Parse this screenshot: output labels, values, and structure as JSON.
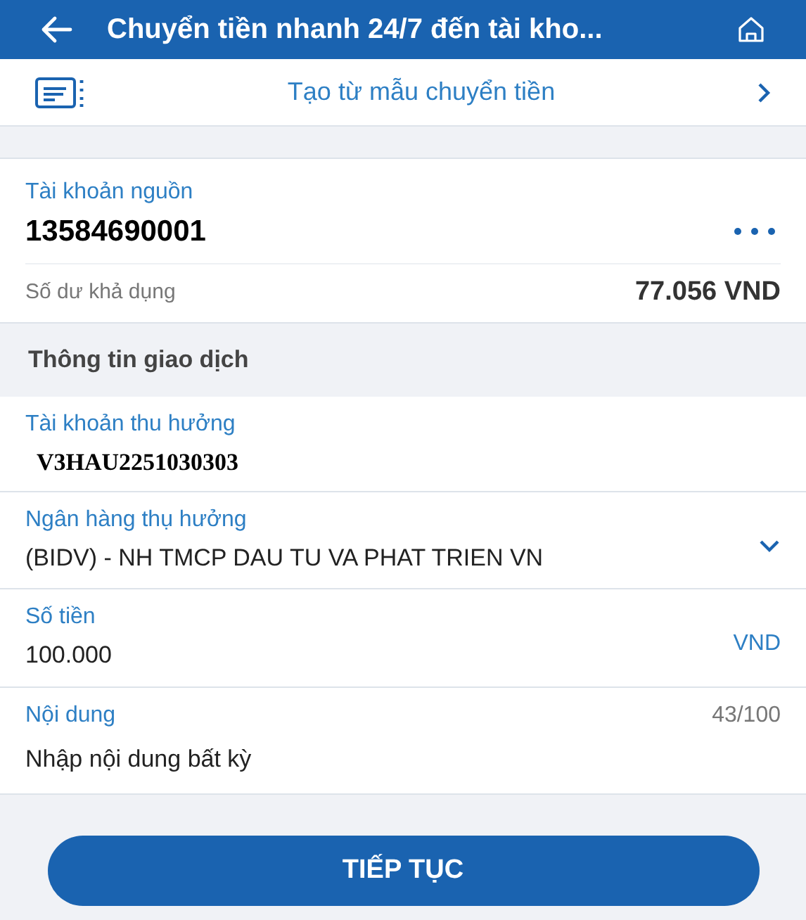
{
  "header": {
    "title": "Chuyển tiền nhanh 24/7 đến tài kho..."
  },
  "template": {
    "label": "Tạo từ mẫu chuyển tiền"
  },
  "source": {
    "label": "Tài khoản nguồn",
    "account": "13584690001",
    "balance_label": "Số dư khả dụng",
    "balance": "77.056 VND"
  },
  "section": {
    "title": "Thông tin giao dịch"
  },
  "fields": [
    {
      "kind": "account",
      "label": "Tài khoản thu hưởng",
      "value": "V3HAU2251030303"
    },
    {
      "kind": "select",
      "label": "Ngân hàng thụ hưởng",
      "value": "(BIDV) - NH TMCP DAU TU VA PHAT TRIEN VN"
    },
    {
      "kind": "amount",
      "label": "Số tiền",
      "value": "100.000",
      "unit": "VND"
    },
    {
      "kind": "text",
      "label": "Nội dung",
      "value": "Nhập nội dung bất kỳ",
      "counter": "43/100"
    }
  ],
  "button": {
    "label": "TIẾP TỤC"
  }
}
